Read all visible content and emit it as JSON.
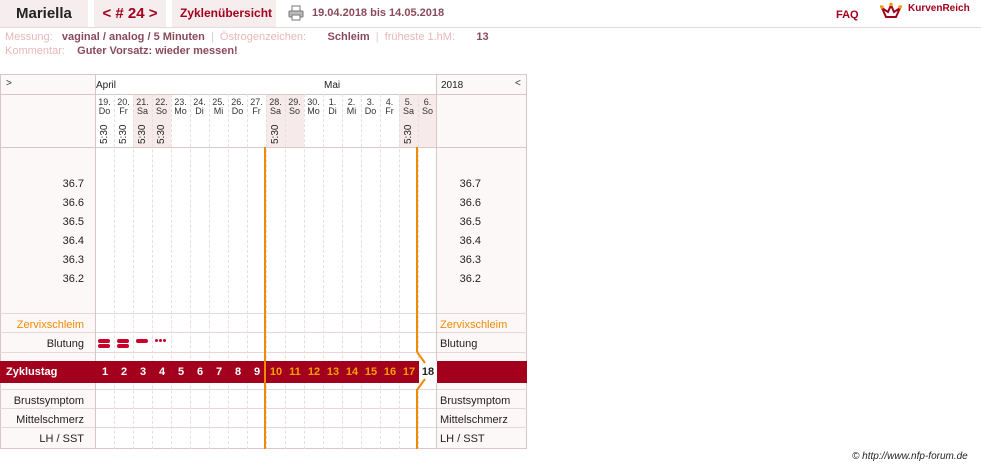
{
  "header": {
    "name": "Mariella",
    "cycle_prev": "<",
    "cycle_label": "# 24",
    "cycle_next": ">",
    "tab_label": "Zyklenübersicht",
    "date_range": "19.04.2018 bis 14.05.2018",
    "faq": "FAQ",
    "brand": "KurvenReich"
  },
  "info": {
    "messung_label": "Messung:",
    "messung_value": "vaginal / analog / 5 Minuten",
    "oestrogen_label": "Östrogenzeichen:",
    "oestrogen_value": "Schleim",
    "hm_label": "früheste 1.hM:",
    "hm_value": "13",
    "kommentar_label": "Kommentar:",
    "kommentar_value": "Guter Vorsatz: wieder messen!"
  },
  "chart": {
    "nav_left": ">",
    "nav_right": "<",
    "month_april": "April",
    "month_mai": "Mai",
    "year": "2018",
    "days": [
      {
        "d": "19.",
        "w": "Do",
        "t": "5:30",
        "we": false
      },
      {
        "d": "20.",
        "w": "Fr",
        "t": "5:30",
        "we": false
      },
      {
        "d": "21.",
        "w": "Sa",
        "t": "5:30",
        "we": true
      },
      {
        "d": "22.",
        "w": "So",
        "t": "5:30",
        "we": true
      },
      {
        "d": "23.",
        "w": "Mo",
        "t": "",
        "we": false
      },
      {
        "d": "24.",
        "w": "Di",
        "t": "",
        "we": false
      },
      {
        "d": "25.",
        "w": "Mi",
        "t": "",
        "we": false
      },
      {
        "d": "26.",
        "w": "Do",
        "t": "",
        "we": false
      },
      {
        "d": "27.",
        "w": "Fr",
        "t": "",
        "we": false
      },
      {
        "d": "28.",
        "w": "Sa",
        "t": "5:30",
        "we": true
      },
      {
        "d": "29.",
        "w": "So",
        "t": "",
        "we": true
      },
      {
        "d": "30.",
        "w": "Mo",
        "t": "",
        "we": false
      },
      {
        "d": "1.",
        "w": "Di",
        "t": "",
        "we": false
      },
      {
        "d": "2.",
        "w": "Mi",
        "t": "",
        "we": false
      },
      {
        "d": "3.",
        "w": "Do",
        "t": "",
        "we": false
      },
      {
        "d": "4.",
        "w": "Fr",
        "t": "",
        "we": false
      },
      {
        "d": "5.",
        "w": "Sa",
        "t": "5:30",
        "we": true
      },
      {
        "d": "6.",
        "w": "So",
        "t": "",
        "we": true
      }
    ],
    "temps": [
      "36.7",
      "36.6",
      "36.5",
      "36.4",
      "36.3",
      "36.2"
    ],
    "rows": {
      "zervix": "Zervixschleim",
      "blutung": "Blutung",
      "zyklustag": "Zyklustag",
      "brust": "Brustsymptom",
      "mittel": "Mittelschmerz",
      "lh": "LH / SST"
    },
    "cycle_days": [
      "1",
      "2",
      "3",
      "4",
      "5",
      "6",
      "7",
      "8",
      "9",
      "10",
      "11",
      "12",
      "13",
      "14",
      "15",
      "16",
      "17",
      "18"
    ],
    "bleeding": [
      "heavy",
      "heavy",
      "medium",
      "spotting"
    ],
    "highlight_color": "#f08a00",
    "accent_color": "#a3001e"
  },
  "footer": {
    "copyright": "© http://www.nfp-forum.de"
  }
}
